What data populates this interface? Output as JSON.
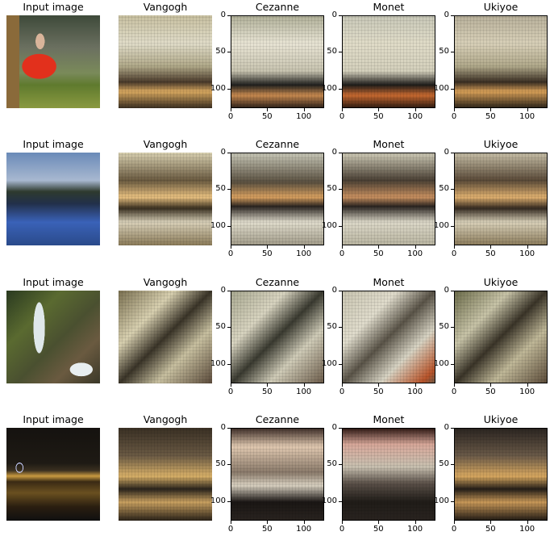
{
  "columns": [
    {
      "title": "Input image"
    },
    {
      "title": "Vangogh"
    },
    {
      "title": "Cezanne"
    },
    {
      "title": "Monet"
    },
    {
      "title": "Ukiyoe"
    }
  ],
  "axis": {
    "x_ticks": [
      "0",
      "50",
      "100"
    ],
    "y_ticks": [
      "0",
      "50",
      "100"
    ]
  },
  "rows": [
    {
      "scene": "person-tree-field"
    },
    {
      "scene": "mountain-lake"
    },
    {
      "scene": "waterfall-forest"
    },
    {
      "scene": "night-city-skyline"
    }
  ],
  "palette": {
    "sky_blue": "#5a86c8",
    "shirt_red": "#e2301c",
    "grass_green": "#5f7a2e",
    "night_dark": "#1a1410",
    "canvas_beige": "#d8d2b8"
  }
}
